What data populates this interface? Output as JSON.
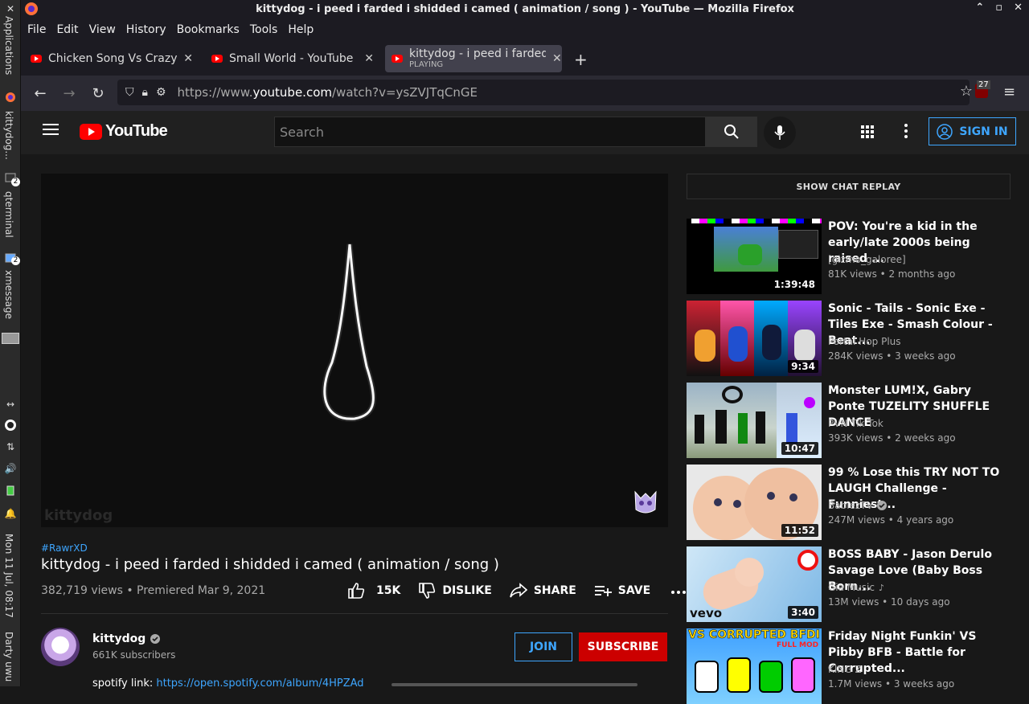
{
  "panel": {
    "items": [
      "Applications",
      "kittydog...",
      "qterminal",
      "xmessage"
    ],
    "badges": [
      "2",
      "2"
    ],
    "clock": "Mon 11 Jul, 08:17",
    "user": "Darty uwu"
  },
  "window": {
    "title": "kittydog - i peed i farded i shidded i camed ( animation / song ) - YouTube — Mozilla Firefox"
  },
  "menu": [
    "File",
    "Edit",
    "View",
    "History",
    "Bookmarks",
    "Tools",
    "Help"
  ],
  "tabs": [
    {
      "label": "Chicken Song Vs Crazy Fr",
      "sub": ""
    },
    {
      "label": "Small World - YouTube",
      "sub": ""
    },
    {
      "label": "kittydog - i peed i farded",
      "sub": "PLAYING"
    }
  ],
  "url": {
    "prefix": "https://www.",
    "host": "youtube.com",
    "path": "/watch?v=ysZVJTqCnGE"
  },
  "toolbar": {
    "ublock_count": "27"
  },
  "youtube": {
    "logo": "YouTube",
    "search_placeholder": "Search",
    "signin": "SIGN IN"
  },
  "video": {
    "watermark": "kittydog",
    "hashtag": "#RawrXD",
    "title": "kittydog - i peed i farded i shidded i camed ( animation / song )",
    "views": "382,719 views • Premiered Mar 9, 2021",
    "likes": "15K",
    "dislike": "DISLIKE",
    "share": "SHARE",
    "save": "SAVE"
  },
  "channel": {
    "name": "kittydog",
    "subs": "661K subscribers",
    "join": "JOIN",
    "subscribe": "SUBSCRIBE",
    "desc_prefix": "spotify link: ",
    "desc_link": "https://open.spotify.com/album/4HPZAd"
  },
  "chat_replay": "SHOW CHAT REPLAY",
  "recommendations": [
    {
      "title": "POV: You're a kid in the early/late 2000s being raised ...",
      "channel": "[gizmo_galoree]",
      "meta": "81K views • 2 months ago",
      "duration": "1:39:48"
    },
    {
      "title": "Sonic - Tails - Sonic Exe - Tiles Exe - Smash Colour - Beat...",
      "channel": "Portal Hop Plus",
      "meta": "284K views • 3 weeks ago",
      "duration": "9:34"
    },
    {
      "title": "Monster LUM!X, Gabry Ponte TUZELITY SHUFFLE DANCE",
      "channel": "PVN Tik Tok",
      "meta": "393K views • 2 weeks ago",
      "duration": "10:47"
    },
    {
      "title": "99 % Lose this TRY NOT TO LAUGH Challenge - Funniest...",
      "channel": "BabiezTV",
      "meta": "247M views • 4 years ago",
      "duration": "11:52"
    },
    {
      "title": "BOSS BABY - Jason Derulo Savage Love (Baby Boss Born...",
      "channel": "Gia Music",
      "meta": "13M views • 10 days ago",
      "duration": "3:40"
    },
    {
      "title": "Friday Night Funkin' VS Pibby BFB - Battle for Corrupted...",
      "channel": "KING Z",
      "meta": "1.7M views • 3 weeks ago",
      "duration": ""
    }
  ],
  "thumb_text": {
    "vevo": "vevo",
    "bfdi": "VS CORRUPTED BFDI",
    "bfdi_sub": "FULL MOD"
  }
}
